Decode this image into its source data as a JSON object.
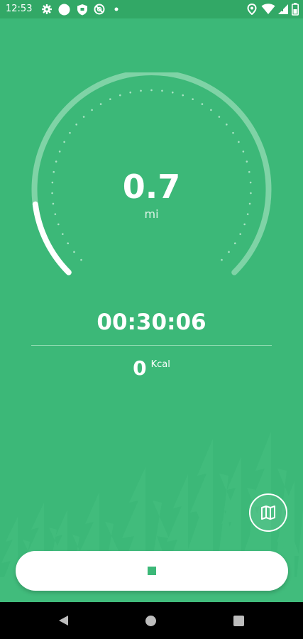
{
  "status_bar": {
    "time": "12:53",
    "left_icons": [
      "gear-icon",
      "circle-icon",
      "shield-icon",
      "no-sync-icon",
      "dot-icon"
    ],
    "right_icons": [
      "location-icon",
      "wifi-icon",
      "signal-icon",
      "battery-icon"
    ]
  },
  "workout": {
    "distance_value": "0.7",
    "distance_unit": "mi",
    "progress_fraction": 0.14,
    "elapsed_time": "00:30:06",
    "calories_value": "0",
    "calories_unit": "Kcal"
  },
  "buttons": {
    "map_icon": "map-icon",
    "stop_icon": "stop-icon"
  },
  "navigation": {
    "icons": [
      "back-icon",
      "home-icon",
      "recents-icon"
    ]
  },
  "colors": {
    "background": "#3cb878",
    "status_bar": "#32a866",
    "accent": "#ffffff"
  }
}
